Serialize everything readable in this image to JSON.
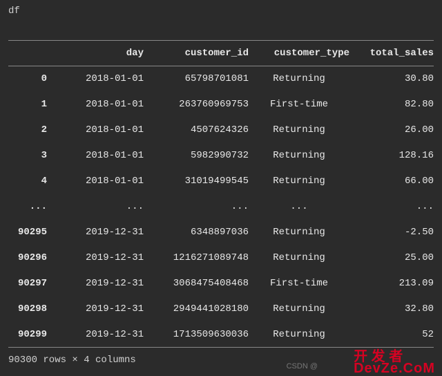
{
  "cell_label": "df",
  "columns": [
    "day",
    "customer_id",
    "customer_type",
    "total_sales"
  ],
  "rows": [
    {
      "index": "0",
      "day": "2018-01-01",
      "customer_id": "65798701081",
      "customer_type": "Returning",
      "total_sales": "30.80"
    },
    {
      "index": "1",
      "day": "2018-01-01",
      "customer_id": "263760969753",
      "customer_type": "First-time",
      "total_sales": "82.80"
    },
    {
      "index": "2",
      "day": "2018-01-01",
      "customer_id": "4507624326",
      "customer_type": "Returning",
      "total_sales": "26.00"
    },
    {
      "index": "3",
      "day": "2018-01-01",
      "customer_id": "5982990732",
      "customer_type": "Returning",
      "total_sales": "128.16"
    },
    {
      "index": "4",
      "day": "2018-01-01",
      "customer_id": "31019499545",
      "customer_type": "Returning",
      "total_sales": "66.00"
    },
    {
      "index": "...",
      "day": "...",
      "customer_id": "...",
      "customer_type": "...",
      "total_sales": "..."
    },
    {
      "index": "90295",
      "day": "2019-12-31",
      "customer_id": "6348897036",
      "customer_type": "Returning",
      "total_sales": "-2.50"
    },
    {
      "index": "90296",
      "day": "2019-12-31",
      "customer_id": "1216271089748",
      "customer_type": "Returning",
      "total_sales": "25.00"
    },
    {
      "index": "90297",
      "day": "2019-12-31",
      "customer_id": "3068475408468",
      "customer_type": "First-time",
      "total_sales": "213.09"
    },
    {
      "index": "90298",
      "day": "2019-12-31",
      "customer_id": "2949441028180",
      "customer_type": "Returning",
      "total_sales": "32.80"
    },
    {
      "index": "90299",
      "day": "2019-12-31",
      "customer_id": "1713509630036",
      "customer_type": "Returning",
      "total_sales": "52"
    }
  ],
  "footer": "90300 rows × 4 columns",
  "attribution": "CSDN @",
  "watermark": {
    "line1": "开 发 者",
    "line2": "DevZe.CoM"
  }
}
